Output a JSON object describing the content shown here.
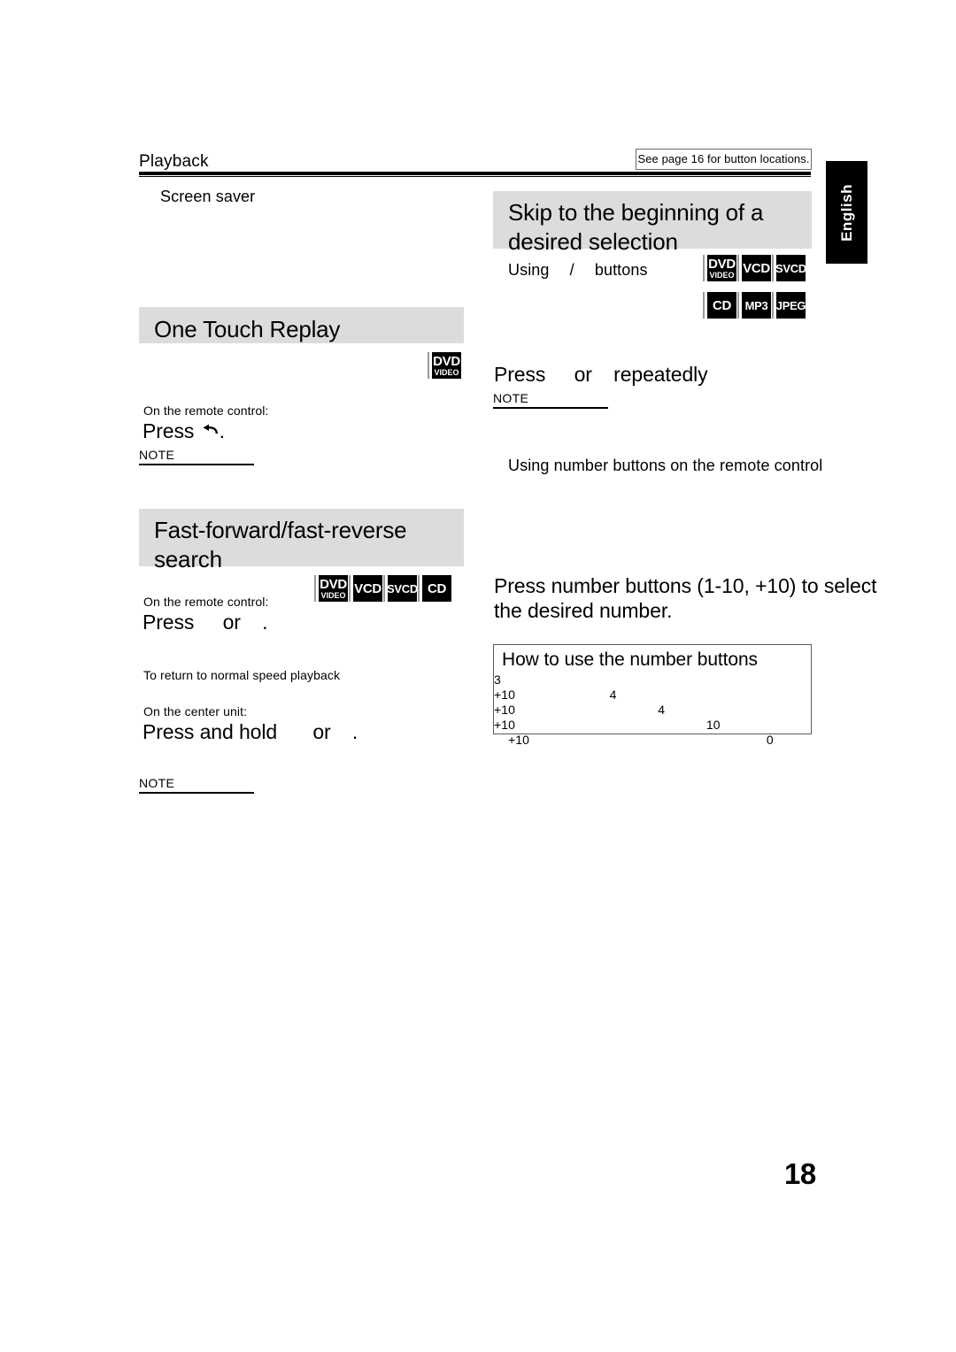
{
  "document": {
    "running_head": "Playback",
    "see_page_note": "See page 16 for button locations.",
    "language_tab": "English",
    "page_number": "18"
  },
  "left_column": {
    "screen_saver_label": "Screen saver",
    "section_one_touch_replay": {
      "heading": "One Touch Replay",
      "badges": [
        {
          "main": "DVD",
          "sub": "VIDEO"
        }
      ],
      "lead": "On the remote control:",
      "instruction_before": "Press",
      "instruction_after": ".",
      "instruction_icon": "replay-arrow-icon",
      "note_label": "NOTE"
    },
    "section_fast_search": {
      "heading_line1": "Fast-forward/fast-reverse",
      "heading_line2": "search",
      "badges": [
        {
          "main": "DVD",
          "sub": "VIDEO"
        },
        {
          "main": "VCD",
          "sub": ""
        },
        {
          "main": "SVCD",
          "sub": ""
        },
        {
          "main": "CD",
          "sub": ""
        }
      ],
      "lead_remote": "On the remote control:",
      "instruction_remote_a": "Press",
      "instruction_remote_b": "or",
      "instruction_remote_c": ".",
      "return_normal_text": "To return to normal speed playback",
      "lead_center": "On the center unit:",
      "instruction_center_a": "Press and hold",
      "instruction_center_b": "or",
      "instruction_center_c": ".",
      "note_label": "NOTE"
    }
  },
  "right_column": {
    "section_skip": {
      "heading_line1": "Skip to the beginning of a",
      "heading_line2": "desired selection",
      "badges_row1": [
        {
          "main": "DVD",
          "sub": "VIDEO"
        },
        {
          "main": "VCD",
          "sub": ""
        },
        {
          "main": "SVCD",
          "sub": ""
        }
      ],
      "badges_row2": [
        {
          "main": "CD",
          "sub": ""
        },
        {
          "main": "MP3",
          "sub": ""
        },
        {
          "main": "JPEG",
          "sub": ""
        }
      ],
      "subhead_a": "Using",
      "subhead_slash": "/",
      "subhead_b": "buttons",
      "badge_dvd": {
        "main": "DVD",
        "sub": "VIDEO"
      },
      "instruction_a": "Press",
      "instruction_b": "or",
      "instruction_c": "repeatedly",
      "note_label": "NOTE",
      "subhead_number": "Using number buttons on the remote control",
      "instruction_number_line1": "Press number buttons (1-10, +10) to select",
      "instruction_number_line2": "the desired number.",
      "howto": {
        "title": "How to use the number buttons",
        "rows": [
          {
            "a": "3",
            "b": "",
            "c": "",
            "d": "",
            "e": ""
          },
          {
            "a": "+10",
            "b": "4",
            "c": "",
            "d": "",
            "e": ""
          },
          {
            "a": "+10",
            "b": "",
            "c": "4",
            "d": "",
            "e": ""
          },
          {
            "a": "+10",
            "b": "",
            "c": "",
            "d": "10",
            "e": ""
          },
          {
            "a": "+10",
            "b": "",
            "c": "",
            "d": "",
            "e": "0"
          }
        ]
      }
    }
  }
}
